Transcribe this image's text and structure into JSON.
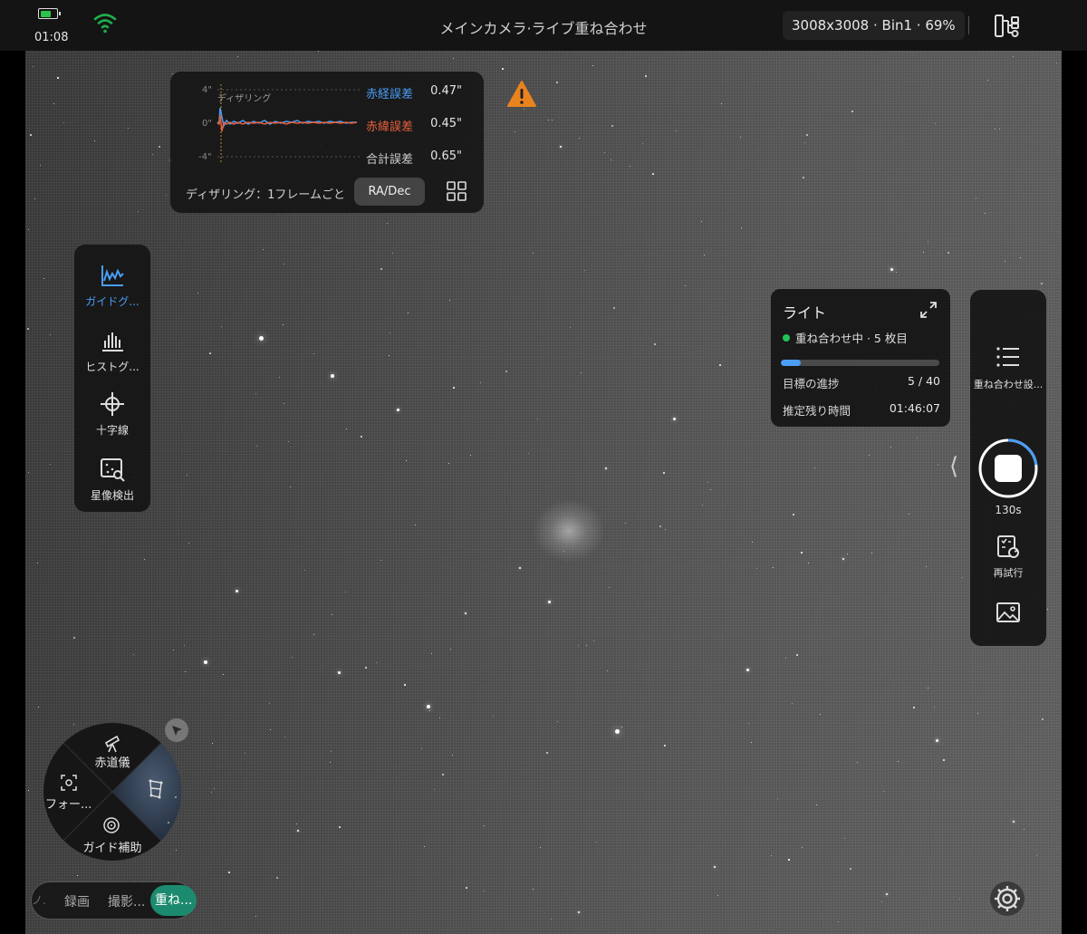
{
  "status_bar": {
    "time": "01:08",
    "battery_fraction": 0.7,
    "battery_color": "#2ec44a",
    "wifi_color": "#1fae4a"
  },
  "header": {
    "title": "メインカメラ·ライブ重ね合わせ",
    "camera_info": "3008x3008 · Bin1 · 69%"
  },
  "guide_graph": {
    "y_ticks": [
      "4\"",
      "0\"",
      "-4\""
    ],
    "marker_label": "ディザリング",
    "errors": [
      {
        "label": "赤経誤差",
        "value": "0.47\"",
        "color": "#4b9df5"
      },
      {
        "label": "赤緯誤差",
        "value": "0.45\"",
        "color": "#e8603c"
      },
      {
        "label": "合計誤差",
        "value": "0.65\"",
        "color": "#d0d0d0"
      }
    ],
    "dither_text": "ディザリング：1フレームごと",
    "axis_button": "RA/Dec"
  },
  "left_tools": [
    {
      "label": "ガイドグ...",
      "icon": "guide-graph-icon",
      "active": true
    },
    {
      "label": "ヒストグ...",
      "icon": "histogram-icon",
      "active": false
    },
    {
      "label": "十字線",
      "icon": "crosshair-icon",
      "active": false
    },
    {
      "label": "星像検出",
      "icon": "star-detect-icon",
      "active": false
    }
  ],
  "stack_card": {
    "title": "ライト",
    "status": "重ね合わせ中 · 5 枚目",
    "progress_label": "目標の進捗",
    "progress_value": "5 / 40",
    "progress_fraction": 0.125,
    "remaining_label": "推定残り時間",
    "remaining_value": "01:46:07"
  },
  "capture_panel": {
    "stack_settings_label": "重ね合わせ設...",
    "exposure_label": "130s",
    "exposure_fraction": 0.23,
    "retry_label": "再試行"
  },
  "dial": {
    "top": "赤道儀",
    "left": "フォー...",
    "bottom": "ガイド補助"
  },
  "modes": [
    "録画",
    "撮影...",
    "重ね..."
  ],
  "accent": "#4b9df5",
  "mode_active_color": "#1c8a6e"
}
